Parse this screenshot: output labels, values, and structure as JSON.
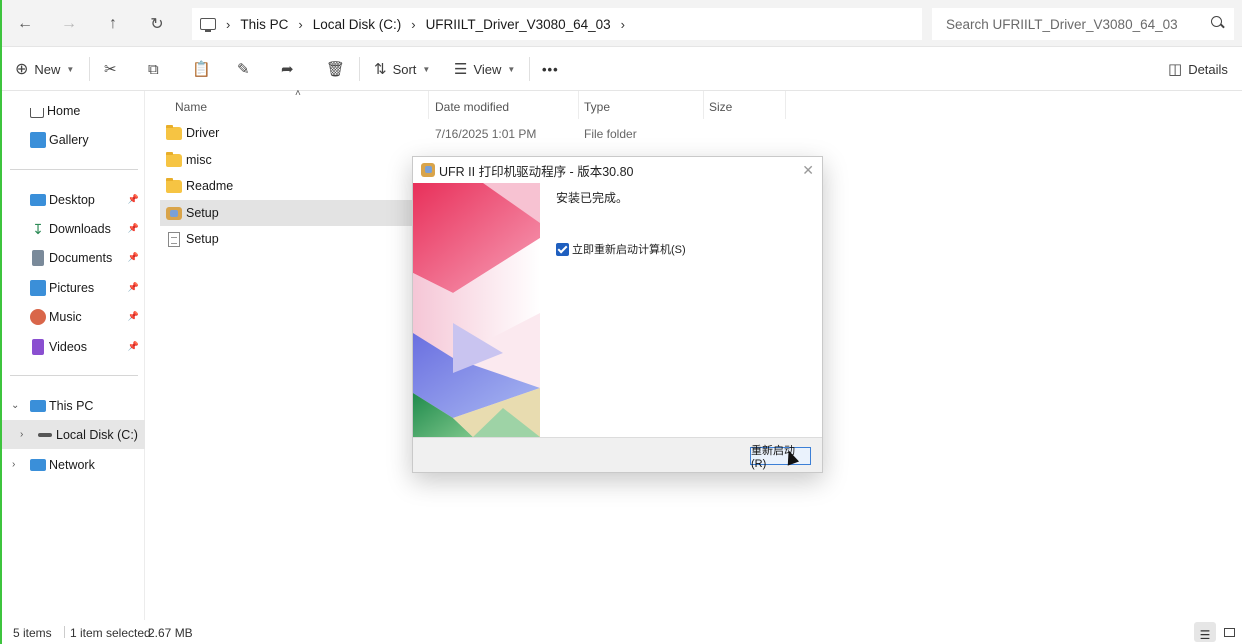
{
  "nav": {
    "back_icon": "back-arrow-icon",
    "forward_icon": "forward-arrow-icon",
    "up_icon": "up-arrow-icon",
    "refresh_icon": "refresh-icon"
  },
  "breadcrumb": {
    "items": [
      "This PC",
      "Local Disk (C:)",
      "UFRIILT_Driver_V3080_64_03"
    ]
  },
  "search": {
    "placeholder": "Search UFRIILT_Driver_V3080_64_03"
  },
  "toolbar": {
    "new_label": "New",
    "sort_label": "Sort",
    "view_label": "View",
    "more_label": "•••",
    "details_label": "Details"
  },
  "sidebar": {
    "quick": [
      {
        "label": "Home",
        "icon": "home-icon"
      },
      {
        "label": "Gallery",
        "icon": "gallery-icon"
      }
    ],
    "pinned": [
      {
        "label": "Desktop",
        "icon": "desktop-icon",
        "color": "#3a8fd9"
      },
      {
        "label": "Downloads",
        "icon": "download-icon",
        "color": "#2e8b57"
      },
      {
        "label": "Documents",
        "icon": "documents-icon",
        "color": "#7a8a9a"
      },
      {
        "label": "Pictures",
        "icon": "pictures-icon",
        "color": "#3b8fd8"
      },
      {
        "label": "Music",
        "icon": "music-icon",
        "color": "#d9664a"
      },
      {
        "label": "Videos",
        "icon": "videos-icon",
        "color": "#8a4fd0"
      }
    ],
    "tree": [
      {
        "label": "This PC",
        "icon": "computer-icon"
      },
      {
        "label": "Local Disk (C:)",
        "icon": "drive-icon"
      },
      {
        "label": "Network",
        "icon": "network-icon"
      }
    ]
  },
  "columns": [
    "Name",
    "Date modified",
    "Type",
    "Size"
  ],
  "files": [
    {
      "name": "Driver",
      "date": "7/16/2025 1:01 PM",
      "type": "File folder",
      "kind": "folder"
    },
    {
      "name": "misc",
      "date": "",
      "type": "",
      "kind": "folder"
    },
    {
      "name": "Readme",
      "date": "",
      "type": "",
      "kind": "folder"
    },
    {
      "name": "Setup",
      "date": "",
      "type": "",
      "kind": "setup"
    },
    {
      "name": "Setup",
      "date": "",
      "type": "",
      "kind": "document"
    }
  ],
  "status": {
    "count": "5 items",
    "selected": "1 item selected",
    "size": "2.67 MB"
  },
  "dialog": {
    "title": "UFR II 打印机驱动程序 - 版本30.80",
    "message": "安装已完成。",
    "checkbox_label": "立即重新启动计算机(S)",
    "button_label": "重新启动(R)"
  },
  "colors": {
    "accent": "#1f5fbf",
    "folder": "#f6c443",
    "selection": "#e3e3e3"
  }
}
